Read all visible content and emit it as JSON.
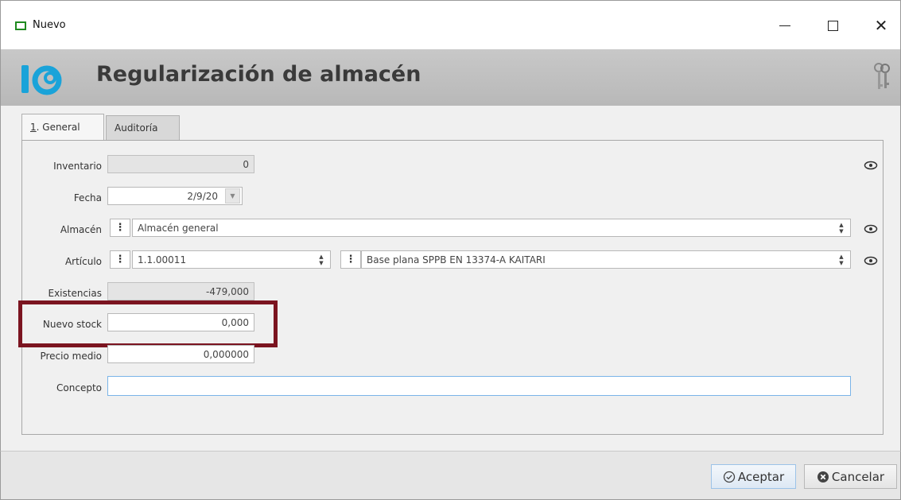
{
  "window": {
    "title": "Nuevo",
    "min_symbol": "—",
    "close_symbol": "✕"
  },
  "header": {
    "title": "Regularización de almacén"
  },
  "tabs": [
    {
      "label_num": "1",
      "label_rest": ". General",
      "active": true
    },
    {
      "label": "Auditoría",
      "active": false
    }
  ],
  "form": {
    "inventario": {
      "label": "Inventario",
      "value": "0"
    },
    "fecha": {
      "label": "Fecha",
      "value": "2/9/20"
    },
    "almacen": {
      "label": "Almacén",
      "value": "Almacén general"
    },
    "articulo": {
      "label": "Artículo",
      "code": "1.1.00011",
      "description": "Base plana SPPB EN 13374-A KAITARI"
    },
    "existencias": {
      "label": "Existencias",
      "value": "-479,000"
    },
    "nuevo_stock": {
      "label": "Nuevo stock",
      "value": "0,000"
    },
    "precio_medio": {
      "label": "Precio medio",
      "value": "0,000000"
    },
    "concepto": {
      "label": "Concepto",
      "value": ""
    }
  },
  "buttons": {
    "accept": "Aceptar",
    "cancel": "Cancelar"
  },
  "colors": {
    "highlight": "#7b1420",
    "logo": "#1aa3d9",
    "accept_border": "#9cc3e8"
  },
  "icons": [
    "window-icon",
    "minimize-icon",
    "maximize-icon",
    "close-icon",
    "app-logo-icon",
    "keys-icon",
    "eye-icon",
    "menu-dots-icon",
    "spinner-icon",
    "dropdown-arrow-icon",
    "check-circle-icon",
    "cancel-x-icon"
  ]
}
